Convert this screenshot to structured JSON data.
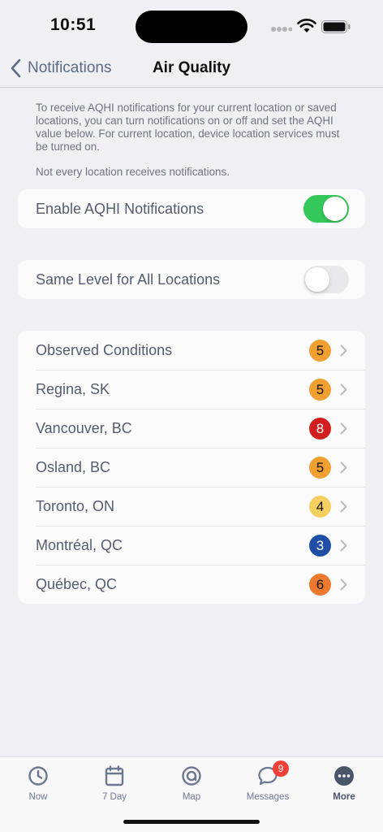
{
  "status_bar": {
    "time": "10:51"
  },
  "nav": {
    "back_label": "Notifications",
    "title": "Air Quality"
  },
  "description": {
    "paragraph1": "To receive AQHI notifications for your current location or saved locations, you can turn notifications on or off and set the AQHI value below. For current location, device location services must be turned on.",
    "paragraph2": "Not every location receives notifications."
  },
  "settings": {
    "enable_label": "Enable AQHI Notifications",
    "enable_on": true,
    "same_level_label": "Same Level for All Locations",
    "same_level_on": false
  },
  "locations": [
    {
      "name": "Observed Conditions",
      "level": "5",
      "color": "#f0a030"
    },
    {
      "name": "Regina, SK",
      "level": "5",
      "color": "#f0a030"
    },
    {
      "name": "Vancouver, BC",
      "level": "8",
      "color": "#d11f1f"
    },
    {
      "name": "Osland, BC",
      "level": "5",
      "color": "#f0a030"
    },
    {
      "name": "Toronto, ON",
      "level": "4",
      "color": "#f5d061"
    },
    {
      "name": "Montréal, QC",
      "level": "3",
      "color": "#1e4ea6"
    },
    {
      "name": "Québec, QC",
      "level": "6",
      "color": "#ec7a2e"
    }
  ],
  "tabs": [
    {
      "label": "Now",
      "icon": "clock-icon"
    },
    {
      "label": "7 Day",
      "icon": "calendar-icon"
    },
    {
      "label": "Map",
      "icon": "map-target-icon"
    },
    {
      "label": "Messages",
      "icon": "chat-bubble-icon",
      "badge": "9"
    },
    {
      "label": "More",
      "icon": "more-dots-icon",
      "active": true
    }
  ]
}
